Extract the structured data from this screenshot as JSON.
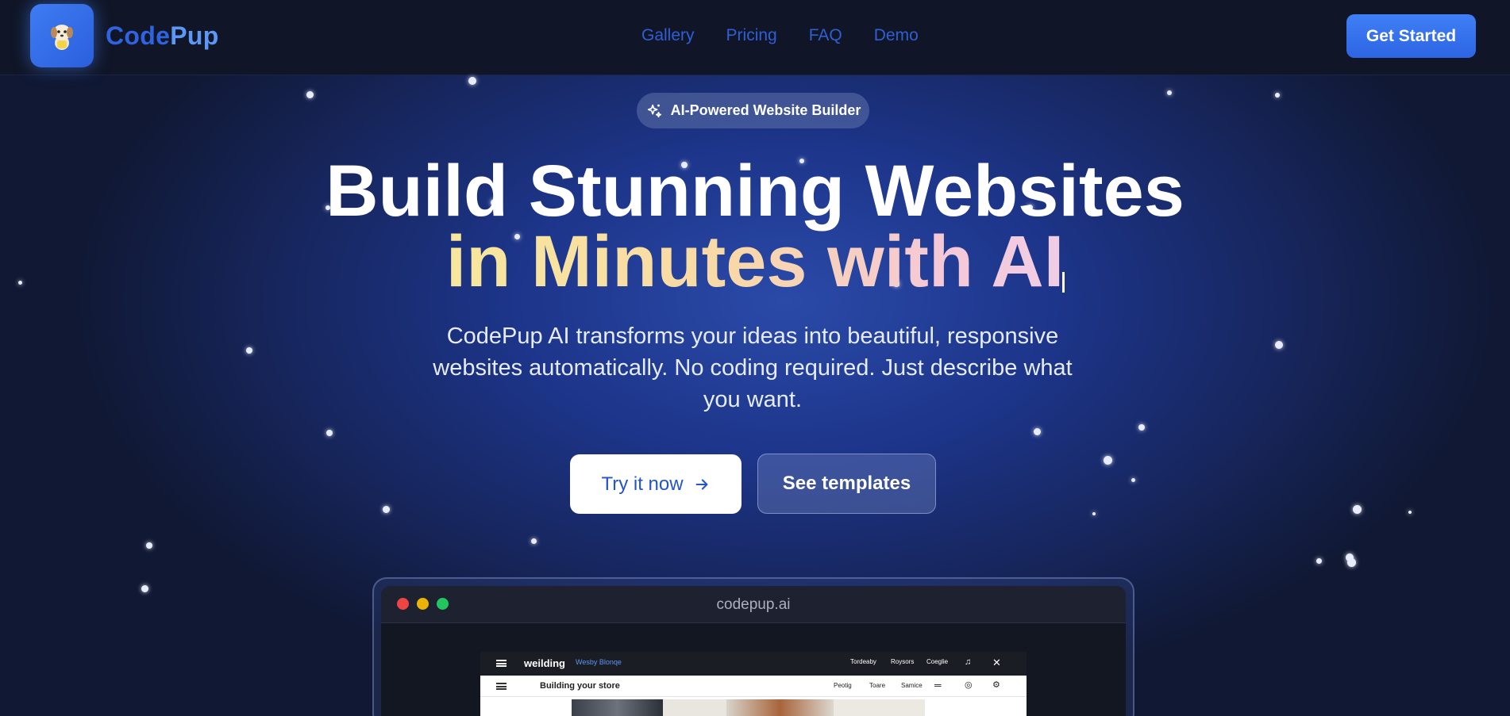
{
  "header": {
    "brand_part1": "Code",
    "brand_part2": "Pup",
    "logo_icon": "puppy-logo-icon",
    "nav": [
      "Gallery",
      "Pricing",
      "FAQ",
      "Demo"
    ],
    "cta": "Get Started"
  },
  "hero": {
    "badge": "AI-Powered Website Builder",
    "badge_icon": "sparkles-icon",
    "headline_line1": "Build Stunning Websites",
    "headline_line2": "in Minutes with AI",
    "subtitle": "CodePup AI transforms your ideas into beautiful, responsive websites automatically. No coding required. Just describe what you want.",
    "primary_button": "Try it now",
    "secondary_button": "See templates"
  },
  "preview": {
    "url": "codepup.ai",
    "inner_site": {
      "logo": "weilding",
      "tag": "Wesby Blonqe",
      "nav": [
        "Tordeaby",
        "Roysors",
        "Coeglie"
      ],
      "page_title": "Building your store",
      "sub_nav": [
        "Peotig",
        "Toare",
        "Samice"
      ]
    }
  },
  "colors": {
    "accent": "#3b78f0",
    "background": "#1d358a",
    "header": "#101627"
  }
}
